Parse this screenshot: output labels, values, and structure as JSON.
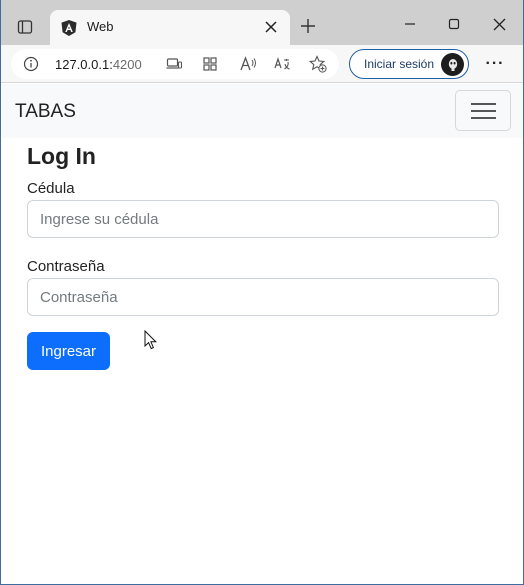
{
  "browser": {
    "tab": {
      "title": "Web"
    },
    "address": {
      "host": "127.0.0.1:",
      "port": "4200"
    },
    "signin_label": "Iniciar sesión",
    "more_label": "···"
  },
  "navbar": {
    "brand": "TABAS"
  },
  "login": {
    "title": "Log In",
    "cedula_label": "Cédula",
    "cedula_placeholder": "Ingrese su cédula",
    "password_label": "Contraseña",
    "password_placeholder": "Contraseña",
    "submit_label": "Ingresar"
  },
  "colors": {
    "primary_button": "#0d6efd",
    "navbar_background": "#f8f9fa",
    "signin_border": "#1f5fa8"
  },
  "icons": [
    "tab-actions-icon",
    "angular-favicon-icon",
    "close-icon",
    "plus-icon",
    "minimize-icon",
    "maximize-icon",
    "close-window-icon",
    "info-icon",
    "device-icon",
    "apps-icon",
    "read-aloud-icon",
    "translate-icon",
    "favorites-icon",
    "avatar-icon",
    "hamburger-icon",
    "cursor-icon"
  ]
}
